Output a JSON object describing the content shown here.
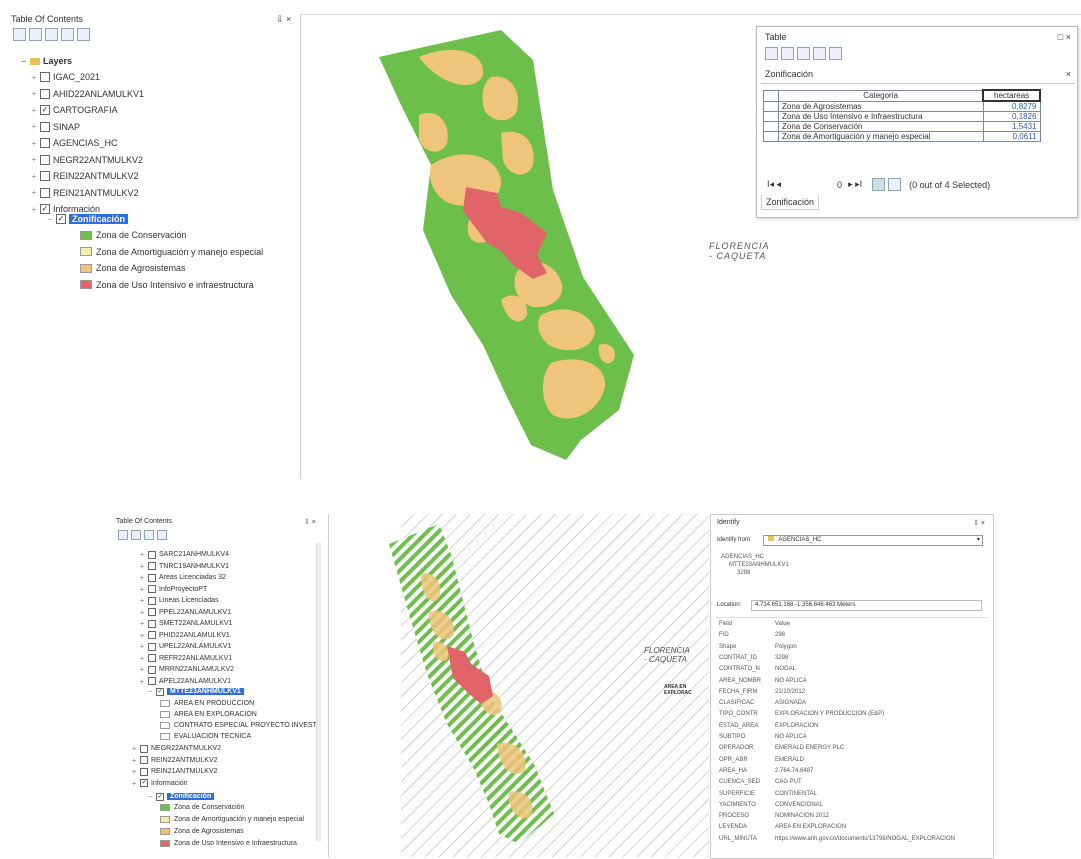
{
  "colors": {
    "conservacion": "#6cbf4a",
    "amortiguacion": "#f3f0a8",
    "agrosistemas": "#efc47c",
    "uso_intensivo": "#e06468",
    "selection": "#2f6fd6"
  },
  "top": {
    "toc": {
      "title": "Table Of Contents",
      "pin": "⇩ ×",
      "root": "Layers",
      "layers": [
        {
          "label": "IGAC_2021",
          "checked": false
        },
        {
          "label": "AHID22ANLAMULKV1",
          "checked": false
        },
        {
          "label": "CARTOGRAFIA",
          "checked": true
        },
        {
          "label": "SINAP",
          "checked": false
        },
        {
          "label": "AGENCIAS_HC",
          "checked": false
        },
        {
          "label": "NEGR22ANTMULKV2",
          "checked": false
        },
        {
          "label": "REIN22ANTMULKV2",
          "checked": false
        },
        {
          "label": "REIN21ANTMULKV2",
          "checked": false
        },
        {
          "label": "Información",
          "checked": true
        }
      ],
      "sublayer": "Zonificación",
      "legend": [
        {
          "label": "Zona de Conservación",
          "color": "conservacion"
        },
        {
          "label": "Zona de Amortiguación y manejo especial",
          "color": "amortiguacion"
        },
        {
          "label": "Zona de Agrosistemas",
          "color": "agrosistemas"
        },
        {
          "label": "Zona de Uso Intensivo e infraestructura",
          "color": "uso_intensivo"
        }
      ]
    },
    "map_label": [
      "FLORENCIA",
      "- CAQUETA"
    ],
    "table": {
      "title": "Table",
      "window_btns": "□ ×",
      "layer_title": "Zonificación",
      "close": "×",
      "headers": [
        "Categoria",
        "hectareas"
      ],
      "rows": [
        [
          "Zona de Agrosistemas",
          "0,8279"
        ],
        [
          "Zona de Uso Intensivo e Infraestructura",
          "0,1826"
        ],
        [
          "Zona de Conservación",
          "1,5431"
        ],
        [
          "Zona de Amortiguación y manejo especial",
          "0,0611"
        ]
      ],
      "nav_left": "I◂ ◂",
      "nav_page": "0",
      "nav_right": "▸ ▸I",
      "selected": "(0 out of 4 Selected)",
      "tab": "Zonificación"
    }
  },
  "bottom": {
    "toc": {
      "title": "Table Of Contents",
      "pin": "⇩ ×",
      "items": [
        {
          "label": "SARC21ANHMULKV4",
          "checked": false
        },
        {
          "label": "TNRC19ANHMULKV1",
          "checked": false
        },
        {
          "label": "Areas Licenciadas 32",
          "checked": false
        },
        {
          "label": "InfoProyectoPT",
          "checked": false
        },
        {
          "label": "Lineas Licenciadas",
          "checked": false
        },
        {
          "label": "PPEL22ANLAMULKV1",
          "checked": false
        },
        {
          "label": "SMET22ANLAMULKV1",
          "checked": false
        },
        {
          "label": "PHID22ANLAMULKV1",
          "checked": false
        },
        {
          "label": "UPEL22ANLAMULKV1",
          "checked": false
        },
        {
          "label": "REFR22ANLAMULKV1",
          "checked": false
        },
        {
          "label": "MRRN22ANLAMULKV2",
          "checked": false
        },
        {
          "label": "APEL22ANLAMULKV1",
          "checked": false
        }
      ],
      "selected_layer": "MTTE23ANHMULKV1",
      "legend_plain": [
        "AREA EN PRODUCCION",
        "AREA EN EXPLORACION",
        "CONTRATO ESPECIAL PROYECTO INVEST",
        "EVALUACION TECNICA"
      ],
      "after": [
        {
          "label": "NEGR22ANTMULKV2",
          "checked": false
        },
        {
          "label": "REIN22ANTMULKV2",
          "checked": false
        },
        {
          "label": "REIN21ANTMULKV2",
          "checked": false
        },
        {
          "label": "Información",
          "checked": true
        }
      ],
      "sublayer": "Zonificación",
      "legend": [
        {
          "label": "Zona de Conservación",
          "color": "conservacion"
        },
        {
          "label": "Zona de Amortiguación y manejo especial",
          "color": "amortiguacion"
        },
        {
          "label": "Zona de Agrosistemas",
          "color": "agrosistemas"
        },
        {
          "label": "Zona de Uso Intensivo e Infraestructura",
          "color": "uso_intensivo"
        }
      ]
    },
    "map_label": [
      "FLORENCIA",
      "- CAQUETA"
    ],
    "map_small_label": [
      "AREA EN",
      "EXPLORAC"
    ],
    "identify": {
      "title": "Identify",
      "pin": "⇩ ×",
      "from_label": "Identify from:",
      "from_value": "AGENCIAS_HC",
      "tree": [
        "AGENCIAS_HC",
        "MTTE23ANHMULKV1",
        "3298"
      ],
      "location_label": "Location:",
      "location_value": "4.714.651.168 -1.356.846.463 Meters",
      "fields": [
        [
          "Field",
          "Value"
        ],
        [
          "FID",
          "298"
        ],
        [
          "Shape",
          "Polygon"
        ],
        [
          "CONTRAT_ID",
          "3298"
        ],
        [
          "CONTRATO_N",
          "NOGAL"
        ],
        [
          "AREA_NOMBR",
          "NO APLICA"
        ],
        [
          "FECHA_FIRM",
          "21/10/2012"
        ],
        [
          "CLASIFICAC",
          "ASIGNADA"
        ],
        [
          "TIPO_CONTR",
          "EXPLORACION Y PRODUCCION (E&P)"
        ],
        [
          "ESTAD_AREA",
          "EXPLORACION"
        ],
        [
          "SUBTIPO",
          "NO APLICA"
        ],
        [
          "OPERADOR",
          "EMERALD ENERGY PLC"
        ],
        [
          "OPR_ABR",
          "EMERALD"
        ],
        [
          "AREA_HA",
          "2.764.74.6487"
        ],
        [
          "CUENCA_SED",
          "CAG PUT"
        ],
        [
          "SUPERFICIE",
          "CONTINENTAL"
        ],
        [
          "YACIMIENTO",
          "CONVENCIONAL"
        ],
        [
          "PROCESO",
          "NOMINACION 2012"
        ],
        [
          "LEYENDA",
          "AREA EN EXPLORACION"
        ],
        [
          "URL_MINUTA",
          "https://www.anh.gov.co/documents/13798/NOGAL_EXPLORACION"
        ]
      ]
    }
  }
}
